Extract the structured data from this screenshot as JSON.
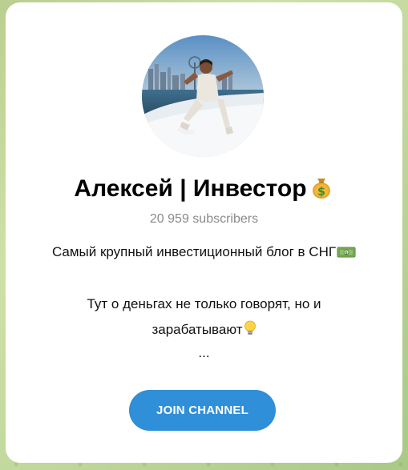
{
  "channel": {
    "name": "Алексей | Инвестор",
    "name_emoji_icon": "money-bag-icon",
    "subscribers": "20 959 subscribers"
  },
  "description": {
    "line1": "Самый крупный инвестиционный блог в СНГ",
    "line1_icon": "banknote-icon",
    "line2": "Тут о деньгах не только говорят, но и",
    "line3": "зарабатывают",
    "line3_icon": "lightbulb-icon",
    "line4": "..."
  },
  "join_button": {
    "label": "JOIN CHANNEL",
    "color": "#2f8fd8"
  },
  "colors": {
    "card_background": "#ffffff",
    "subscribers_text": "#8a8a8a"
  }
}
